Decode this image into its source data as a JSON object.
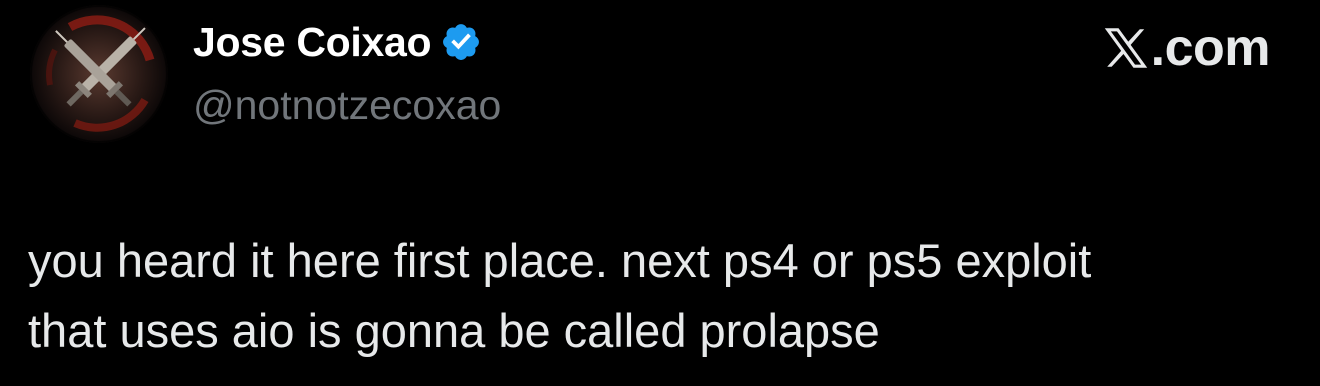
{
  "author": {
    "display_name": "Jose Coixao",
    "handle": "@notnotzecoxao",
    "verified": true,
    "avatar_icon": "crossed-syringes-avatar-icon"
  },
  "brand": {
    "logo_icon": "x-logo-icon",
    "text": ".com"
  },
  "tweet": {
    "lines": [
      "you heard it here first place. next ps4 or ps5 exploit",
      "that uses aio is gonna be called prolapse"
    ]
  },
  "colors": {
    "background": "#000000",
    "name": "#ffffff",
    "handle": "#71767b",
    "body_text": "#e7e9ea",
    "verified_badge": "#1d9bf0"
  }
}
